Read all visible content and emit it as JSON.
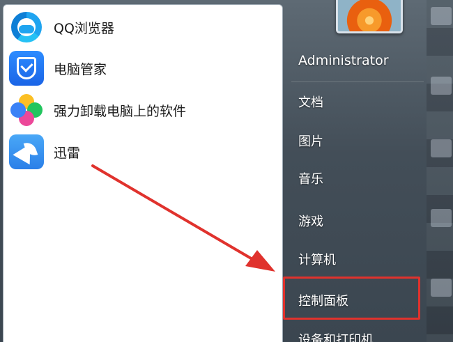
{
  "programs": [
    {
      "label": "QQ浏览器",
      "icon": "qq-browser-icon"
    },
    {
      "label": "电脑管家",
      "icon": "pc-manager-icon"
    },
    {
      "label": "强力卸载电脑上的软件",
      "icon": "uninstaller-icon"
    },
    {
      "label": "迅雷",
      "icon": "xunlei-icon"
    }
  ],
  "right_menu": {
    "user": "Administrator",
    "items": [
      {
        "label": "文档"
      },
      {
        "label": "图片"
      },
      {
        "label": "音乐"
      },
      {
        "label": "游戏"
      },
      {
        "label": "计算机"
      },
      {
        "label": "控制面板"
      },
      {
        "label": "设备和打印机"
      }
    ]
  },
  "annotation": {
    "color": "#e0322d",
    "target": "控制面板"
  }
}
